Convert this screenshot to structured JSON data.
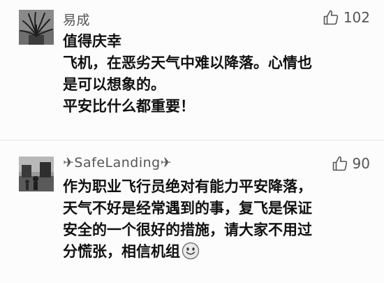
{
  "comments": [
    {
      "username": "易成",
      "like_count": "102",
      "lines": [
        "值得庆幸",
        "飞机，在恶劣天气中难以降落。心情也",
        "是可以想象的。",
        "平安比什么都重要！"
      ]
    },
    {
      "username": "✈SafeLanding✈",
      "like_count": "90",
      "lines": [
        "作为职业飞行员绝对有能力平安降落，",
        "天气不好是经常遇到的事，复飞是保证",
        "安全的一个很好的措施，请大家不用过",
        "分慌张，相信机组"
      ],
      "emoji": "smiley-emoji"
    }
  ],
  "icons": {
    "like": "thumbs-up-icon"
  }
}
